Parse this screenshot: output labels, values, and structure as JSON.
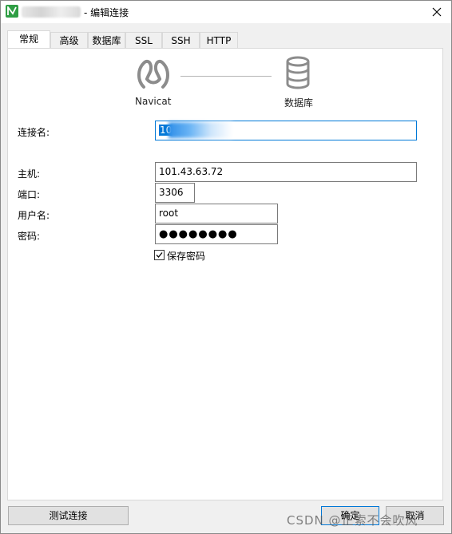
{
  "window": {
    "title": "- 编辑连接",
    "app_icon": "navicat-app-icon",
    "close_icon": "close-icon"
  },
  "tabs": [
    {
      "label": "常规",
      "active": true
    },
    {
      "label": "高级",
      "active": false
    },
    {
      "label": "数据库",
      "active": false
    },
    {
      "label": "SSL",
      "active": false
    },
    {
      "label": "SSH",
      "active": false
    },
    {
      "label": "HTTP",
      "active": false
    }
  ],
  "diagram": {
    "left_label": "Navicat",
    "right_label": "数据库",
    "left_icon": "navicat-logo-icon",
    "right_icon": "database-icon"
  },
  "form": {
    "connection_name_label": "连接名:",
    "connection_name_value": "10",
    "host_label": "主机:",
    "host_value": "101.43.63.72",
    "port_label": "端口:",
    "port_value": "3306",
    "username_label": "用户名:",
    "username_value": "root",
    "password_label": "密码:",
    "password_value": "●●●●●●●●",
    "save_password_label": "保存密码",
    "save_password_checked": true
  },
  "buttons": {
    "test_connection": "测试连接",
    "ok": "确定",
    "cancel": "取消"
  },
  "watermark": "CSDN @正索不会吹风",
  "colors": {
    "accent": "#0078d7",
    "app_icon_green": "#2f9e44"
  }
}
